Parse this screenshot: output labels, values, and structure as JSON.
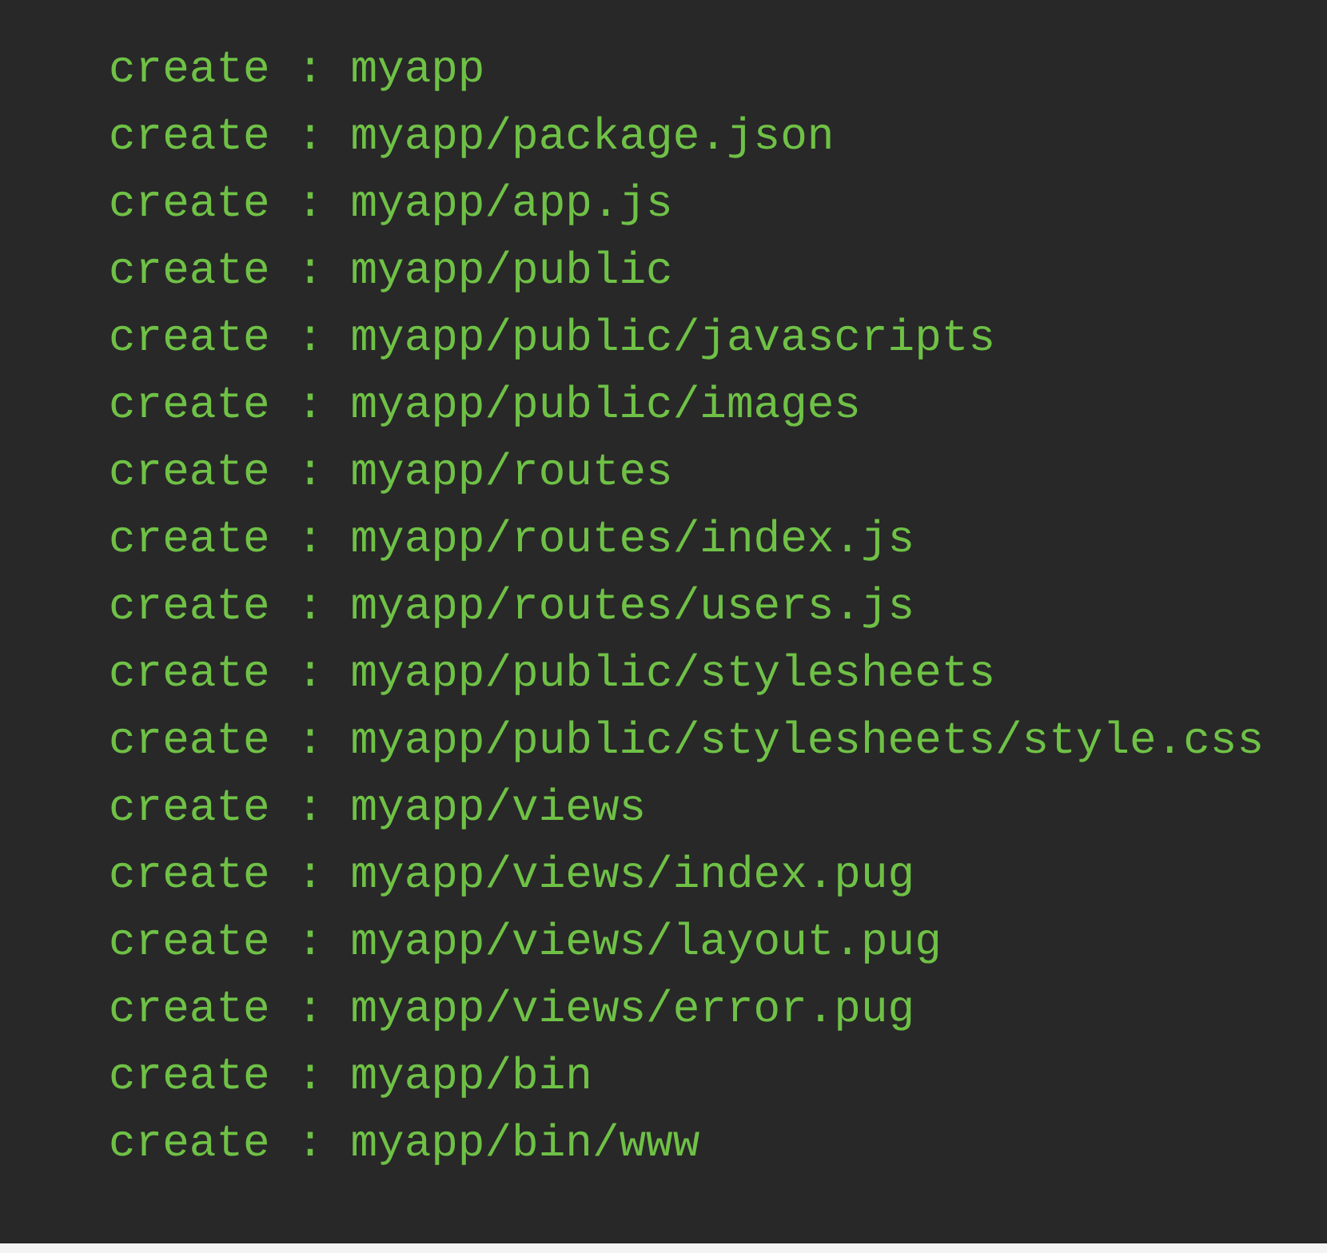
{
  "terminal": {
    "lines": [
      "create : myapp",
      "create : myapp/package.json",
      "create : myapp/app.js",
      "create : myapp/public",
      "create : myapp/public/javascripts",
      "create : myapp/public/images",
      "create : myapp/routes",
      "create : myapp/routes/index.js",
      "create : myapp/routes/users.js",
      "create : myapp/public/stylesheets",
      "create : myapp/public/stylesheets/style.css",
      "create : myapp/views",
      "create : myapp/views/index.pug",
      "create : myapp/views/layout.pug",
      "create : myapp/views/error.pug",
      "create : myapp/bin",
      "create : myapp/bin/www"
    ]
  }
}
